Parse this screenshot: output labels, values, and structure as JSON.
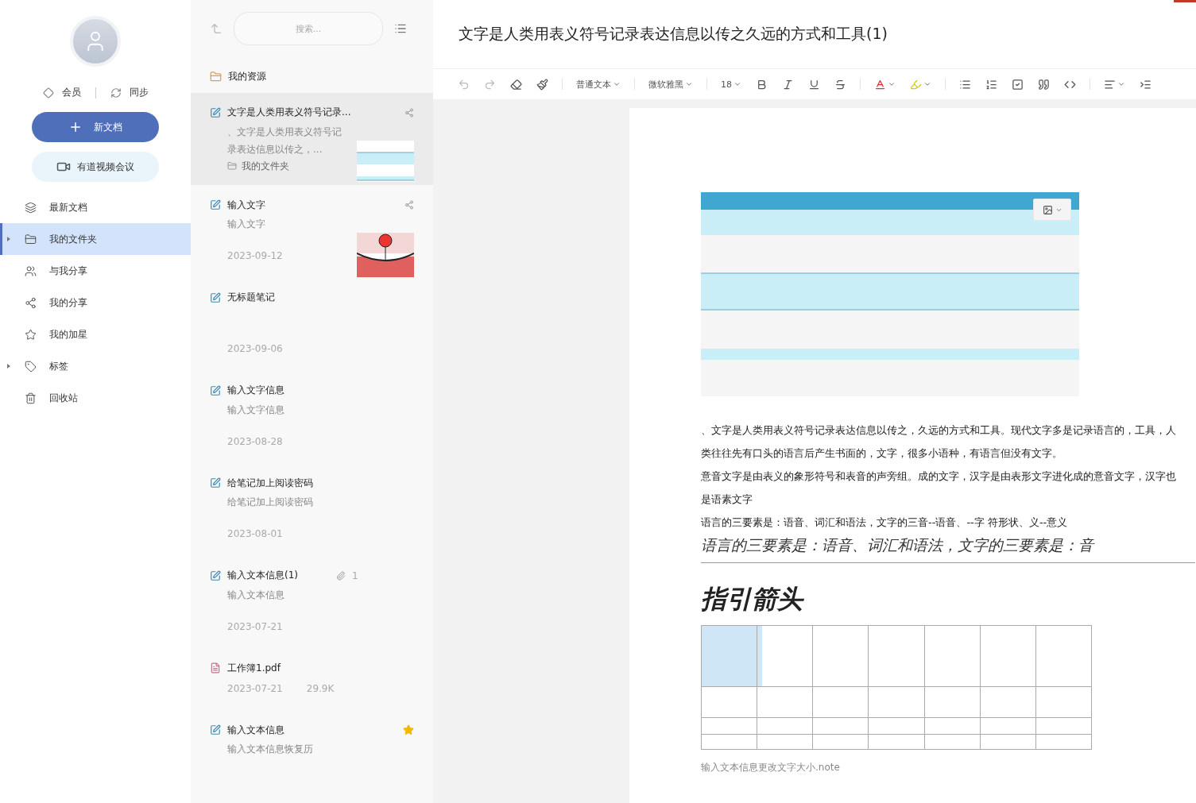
{
  "sidebar": {
    "member": "会员",
    "sync": "同步",
    "new_doc": "新文档",
    "meeting": "有道视频会议",
    "items": [
      {
        "label": "最新文档",
        "selected": false,
        "has_children": false
      },
      {
        "label": "我的文件夹",
        "selected": true,
        "has_children": true
      },
      {
        "label": "与我分享",
        "selected": false,
        "has_children": false
      },
      {
        "label": "我的分享",
        "selected": false,
        "has_children": false
      },
      {
        "label": "我的加星",
        "selected": false,
        "has_children": false
      },
      {
        "label": "标签",
        "selected": false,
        "has_children": true
      },
      {
        "label": "回收站",
        "selected": false,
        "has_children": false
      }
    ]
  },
  "note_list": {
    "search": {
      "placeholder": "搜索..."
    },
    "resources": "我的资源",
    "notes": [
      {
        "kind": "note",
        "title": "文字是人类用表义符号记录...",
        "snippet": "、文字是人类用表义符号记录表达信息以传之，...",
        "folder": "我的文件夹",
        "shared": true,
        "selected": true,
        "starred": false
      },
      {
        "kind": "note",
        "title": "输入文字",
        "snippet": "输入文字",
        "date": "2023-09-12",
        "shared": true,
        "selected": false,
        "starred": false
      },
      {
        "kind": "note",
        "title": "无标题笔记",
        "date": "2023-09-06",
        "shared": false,
        "selected": false,
        "starred": false
      },
      {
        "kind": "note",
        "title": "输入文字信息",
        "snippet": "输入文字信息",
        "date": "2023-08-28",
        "shared": false,
        "selected": false,
        "starred": false
      },
      {
        "kind": "note",
        "title": "给笔记加上阅读密码",
        "snippet": "给笔记加上阅读密码",
        "date": "2023-08-01",
        "shared": false,
        "selected": false,
        "starred": false
      },
      {
        "kind": "note",
        "title": "输入文本信息(1)",
        "attachments": "1",
        "snippet": "输入文本信息",
        "date": "2023-07-21",
        "shared": false,
        "selected": false,
        "starred": false
      },
      {
        "kind": "pdf",
        "title": "工作簿1.pdf",
        "date": "2023-07-21",
        "size": "29.9K",
        "shared": false,
        "selected": false,
        "starred": false
      },
      {
        "kind": "note",
        "title": "输入文本信息",
        "snippet": "输入文本信息恢复历",
        "shared": false,
        "selected": false,
        "starred": true
      }
    ]
  },
  "editor": {
    "title": "文字是人类用表义符号记录表达信息以传之久远的方式和工具(1)",
    "toolbar": {
      "style": "普通文本",
      "font": "微软雅黑",
      "size": "18"
    },
    "paragraphs": [
      "、文字是人类用表义符号记录表达信息以传之，久远的方式和工具。现代文字多是记录语言的，工具，人类往往先有口头的语言后产生书面的，文字，很多小语种，有语言但没有文字。",
      "意音文字是由表义的象形符号和表音的声旁组。成的文字，汉字是由表形文字进化成的意音文字，汉字也是语素文字",
      "语言的三要素是：语音、词汇和语法，文字的三音--语音、--字  符形状、义--意义"
    ],
    "quote": "语言的三要素是：语音、词汇和语法，文字的三要素是：音",
    "heading": "指引箭头",
    "caption": "输入文本信息更改文字大小.note"
  }
}
